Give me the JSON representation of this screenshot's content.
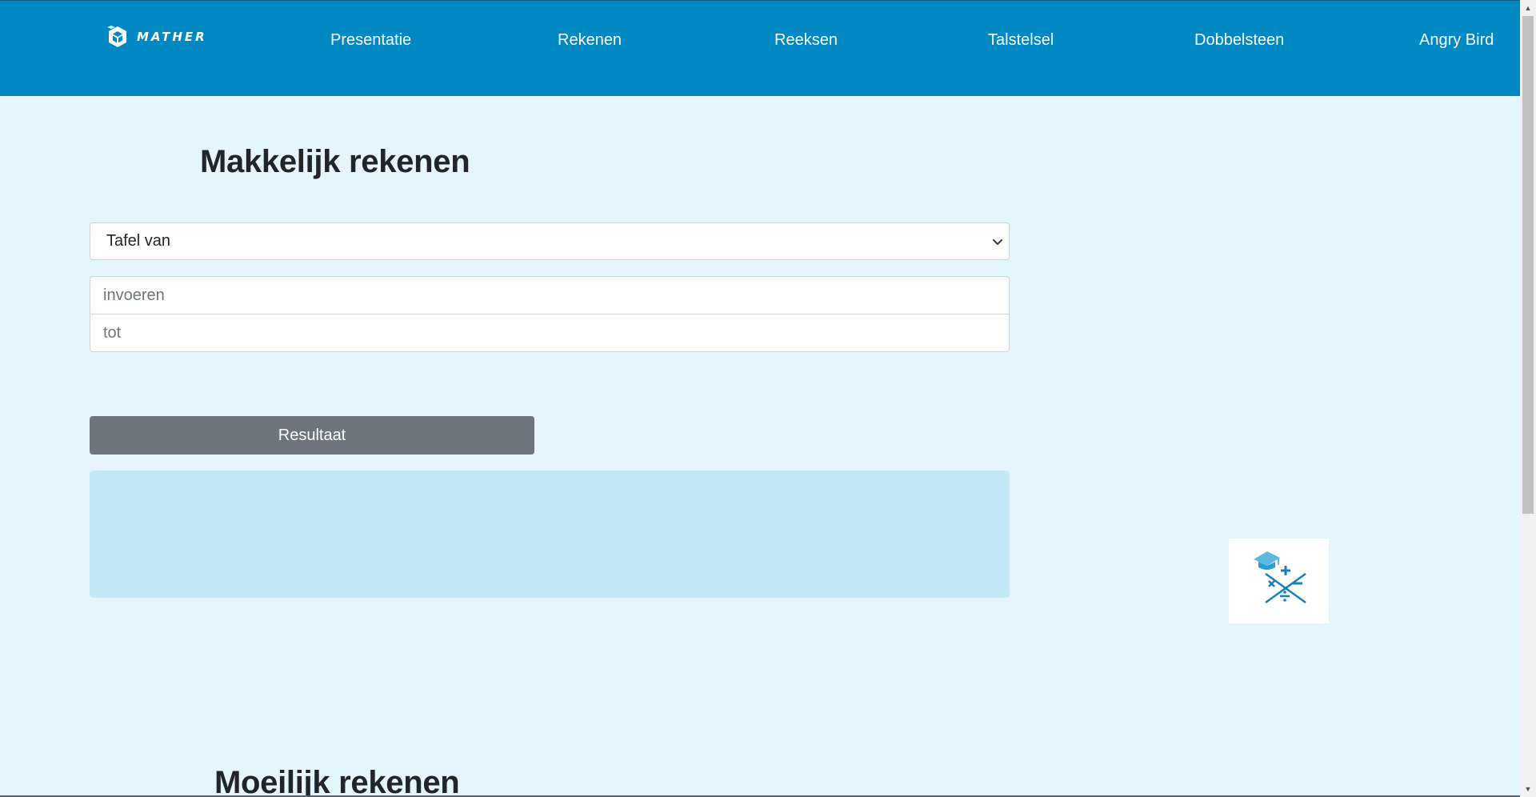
{
  "brand": {
    "name": "MATHER",
    "icon": "hexagon-cube-icon"
  },
  "nav": {
    "items": [
      {
        "label": "Presentatie"
      },
      {
        "label": "Rekenen"
      },
      {
        "label": "Reeksen"
      },
      {
        "label": "Talstelsel"
      },
      {
        "label": "Dobbelsteen"
      },
      {
        "label": "Angry Bird"
      }
    ]
  },
  "easy": {
    "title": "Makkelijk rekenen",
    "select": {
      "selected": "Tafel van",
      "icon": "chevron-down-icon"
    },
    "input_from": {
      "placeholder": "invoeren",
      "value": ""
    },
    "input_to": {
      "placeholder": "tot",
      "value": ""
    },
    "button_label": "Resultaat",
    "result": ""
  },
  "hard": {
    "title": "Moeilijk rekenen"
  },
  "side_logo": {
    "icon": "graduation-cap-math-icon"
  },
  "colors": {
    "navbar": "#0088c2",
    "background": "#e4f5fd",
    "button": "#6c757d",
    "result_box": "#c5e8f7",
    "logo_accent": "#2a9fd6"
  }
}
